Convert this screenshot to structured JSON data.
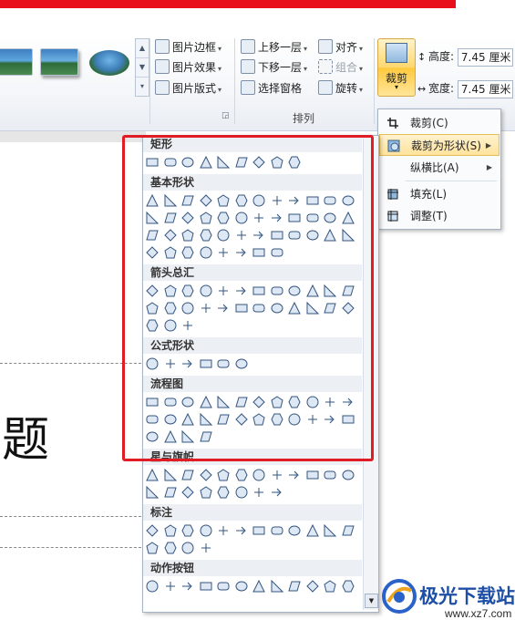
{
  "ribbon": {
    "picture_border": "图片边框",
    "picture_effects": "图片效果",
    "picture_layout": "图片版式",
    "bring_forward": "上移一层",
    "send_backward": "下移一层",
    "selection_pane": "选择窗格",
    "align": "对齐",
    "group": "组合",
    "rotate": "旋转",
    "arrange_group_label": "排列",
    "crop": "裁剪",
    "height_label": "高度:",
    "height_value": "7.45 厘米",
    "width_label": "宽度:",
    "width_value": "7.45 厘米"
  },
  "crop_menu": {
    "items": [
      {
        "label": "裁剪(C)",
        "icon": "crop-icon",
        "has_arrow": false
      },
      {
        "label": "裁剪为形状(S)",
        "icon": "crop-to-shape-icon",
        "has_arrow": true,
        "active": true
      },
      {
        "label": "纵横比(A)",
        "icon": "",
        "has_arrow": true
      },
      {
        "label": "填充(L)",
        "icon": "fill-crop-icon",
        "has_arrow": false
      },
      {
        "label": "调整(T)",
        "icon": "fit-crop-icon",
        "has_arrow": false
      }
    ]
  },
  "shapes_panel": {
    "categories": [
      {
        "name": "矩形",
        "rows": [
          9
        ]
      },
      {
        "name": "基本形状",
        "rows": [
          12,
          12,
          12,
          8
        ]
      },
      {
        "name": "箭头总汇",
        "rows": [
          12,
          12,
          3
        ]
      },
      {
        "name": "公式形状",
        "rows": [
          6
        ]
      },
      {
        "name": "流程图",
        "rows": [
          12,
          12,
          4
        ]
      },
      {
        "name": "星与旗帜",
        "rows": [
          12,
          8
        ]
      },
      {
        "name": "标注",
        "rows": [
          12,
          4
        ]
      },
      {
        "name": "动作按钮",
        "rows": [
          12
        ]
      }
    ]
  },
  "document": {
    "title_char": "题"
  },
  "colors": {
    "highlight": "#e01c24",
    "active_menu": "#ffe39c",
    "shape_stroke": "#35557e",
    "shape_fill": "#dde8f4"
  },
  "watermark": {
    "name": "极光下载站",
    "url": "www.xz7.com"
  }
}
